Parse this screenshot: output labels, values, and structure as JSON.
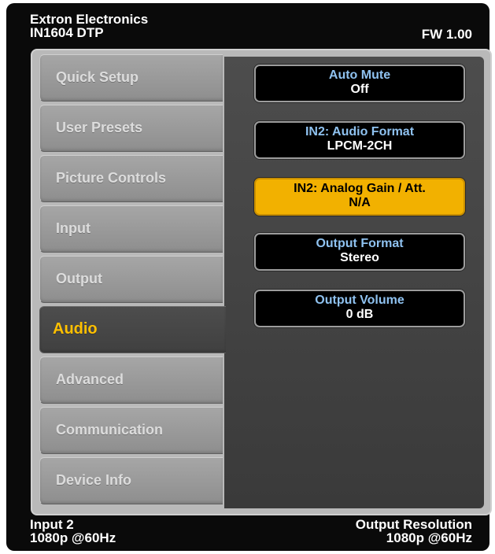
{
  "header": {
    "brand": "Extron Electronics",
    "model": "IN1604 DTP",
    "firmware": "FW 1.00"
  },
  "menu": {
    "items": [
      {
        "label": "Quick Setup"
      },
      {
        "label": "User Presets"
      },
      {
        "label": "Picture Controls"
      },
      {
        "label": "Input"
      },
      {
        "label": "Output"
      },
      {
        "label": "Audio"
      },
      {
        "label": "Advanced"
      },
      {
        "label": "Communication"
      },
      {
        "label": "Device Info"
      }
    ],
    "active": "Audio"
  },
  "audio": {
    "auto_mute": {
      "title": "Auto Mute",
      "value": "Off"
    },
    "audio_format": {
      "title": "IN2: Audio Format",
      "value": "LPCM-2CH"
    },
    "analog_gain": {
      "title": "IN2:  Analog Gain / Att.",
      "value": "N/A"
    },
    "output_format": {
      "title": "Output Format",
      "value": "Stereo"
    },
    "output_volume": {
      "title": "Output Volume",
      "value": "0 dB"
    }
  },
  "footer": {
    "input_label": "Input 2",
    "input_resolution": "1080p @60Hz",
    "output_label": "Output Resolution",
    "output_resolution": "1080p @60Hz"
  },
  "colors": {
    "active_accent": "#ffc000",
    "highlight_button": "#f2b100",
    "button_title": "#8fc2f0"
  }
}
